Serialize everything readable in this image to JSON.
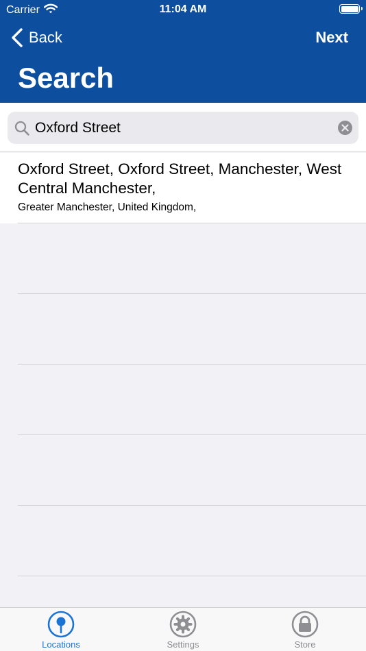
{
  "status_bar": {
    "carrier": "Carrier",
    "time": "11:04 AM"
  },
  "nav": {
    "back_label": "Back",
    "next_label": "Next",
    "title": "Search"
  },
  "search": {
    "value": "Oxford Street"
  },
  "results": [
    {
      "title": "Oxford Street, Oxford Street, Manchester, West Central Manchester,",
      "subtitle": "Greater Manchester, United Kingdom,"
    }
  ],
  "tabs": [
    {
      "label": "Locations",
      "icon": "map-pin-icon",
      "active": true
    },
    {
      "label": "Settings",
      "icon": "gear-icon",
      "active": false
    },
    {
      "label": "Store",
      "icon": "lock-icon",
      "active": false
    }
  ],
  "colors": {
    "nav_bar": "#0d4f9e",
    "accent": "#1a74d6",
    "inactive": "#8e8e93"
  }
}
